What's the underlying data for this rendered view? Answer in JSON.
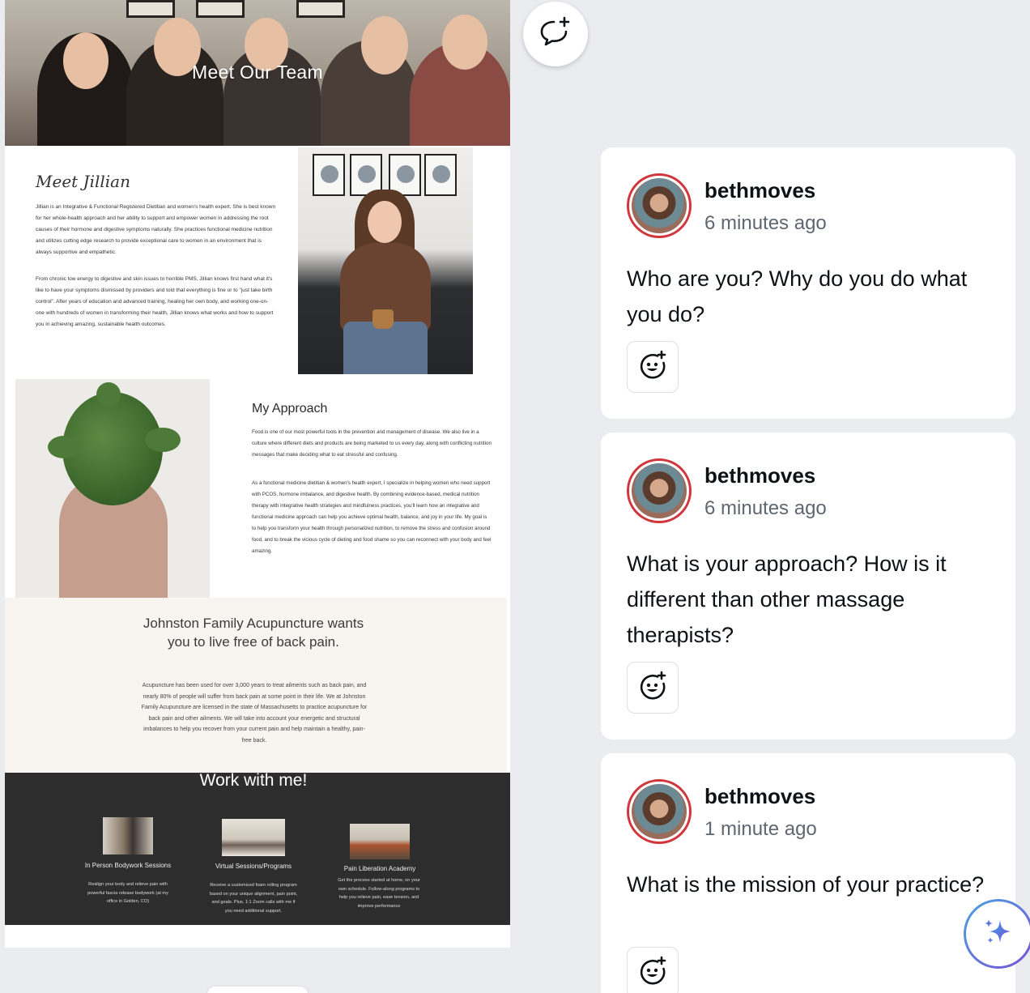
{
  "design": {
    "hero_title": "Meet Our Team",
    "meet_script": "Meet Jillian",
    "bio_p1": "Jillian is an Integrative & Functional Registered Dietitian and women's health expert. She is best known for her whole-health approach and her ability to support and empower women in addressing the root causes of their hormone and digestive symptoms naturally. She practices functional medicine nutrition and utilizes cutting edge research to provide exceptional care to women in an environment that is always supportive and empathetic.",
    "bio_p2": "From chronic low energy to digestive and skin issues to horrible PMS, Jillian knows first hand what it's like to have your symptoms dismissed by providers and told that everything is fine or to \"just take birth control\". After years of education and advanced training, healing her own body, and working one-on-one with hundreds of women in transforming their health, Jillian knows what works and how to support you in achieving amazing, sustainable health outcomes.",
    "approach_title": "My Approach",
    "approach_p1": "Food is one of our most powerful tools in the prevention and management of disease. We also live in a culture where different diets and products are being marketed to us every day, along with conflicting nutrition messages that make deciding what to eat stressful and confusing.",
    "approach_p2": "As a functional medicine dietitian & women's health expert, I specialize in helping women who need support with PCOS, hormone imbalance, and digestive health. By combining evidence-based, medical nutrition therapy with integrative health strategies and mindfulness practices, you'll learn how an integrative and functional medicine approach can help you achieve optimal health, balance, and joy in your life. My goal is to help you transform your health through personalized nutrition, to remove the stress and confusion around food, and to break the vicious cycle of dieting and food shame so you can reconnect with your body and feel amazing.",
    "acu_title": "Johnston Family Acupuncture wants you to live free of back pain.",
    "acu_text": "Acupuncture has been used for over 3,000 years to treat ailments such as back pain, and nearly 80% of people will suffer from back pain at some point in their life. We at Johnston Family Acupuncture are licensed in the state of Massachusetts to practice acupuncture for back pain and other ailments. We will take into account your energetic and structural imbalances to help you recover from your current pain and help maintain a healthy, pain-free back.",
    "work_title": "Work with me!",
    "services": [
      {
        "title": "In Person Bodywork Sessions",
        "desc": "Realign your body and relieve pain with powerful fascia release bodywork (at my office in Golden, CO)"
      },
      {
        "title": "Virtual Sessions/Programs",
        "desc": "Receive a customized foam rolling program based on your unique alignment, pain point, and goals. Plus, 1:1 Zoom calls with me if you need additional support."
      },
      {
        "title": "Pain Liberation Academy",
        "desc": "Get the process started at home, on your own schedule. Follow-along programs to help you relieve pain, ease tension, and improve performance"
      }
    ]
  },
  "comments": [
    {
      "username": "bethmoves",
      "time": "6 minutes ago",
      "text": "Who are you? Why do you do what you do?"
    },
    {
      "username": "bethmoves",
      "time": "6 minutes ago",
      "text": "What is your approach? How is it different than other massage therapists?"
    },
    {
      "username": "bethmoves",
      "time": "1 minute ago",
      "text": "What is the mission of your practice?"
    }
  ],
  "icons": {
    "add_comment": "add-comment-icon",
    "reaction": "add-reaction-icon",
    "magic": "sparkle-icon"
  },
  "colors": {
    "avatar_ring": "#d0363c",
    "background": "#ebecf0",
    "work_section": "#2d2d2d",
    "acu_section": "#f8f4f0"
  }
}
